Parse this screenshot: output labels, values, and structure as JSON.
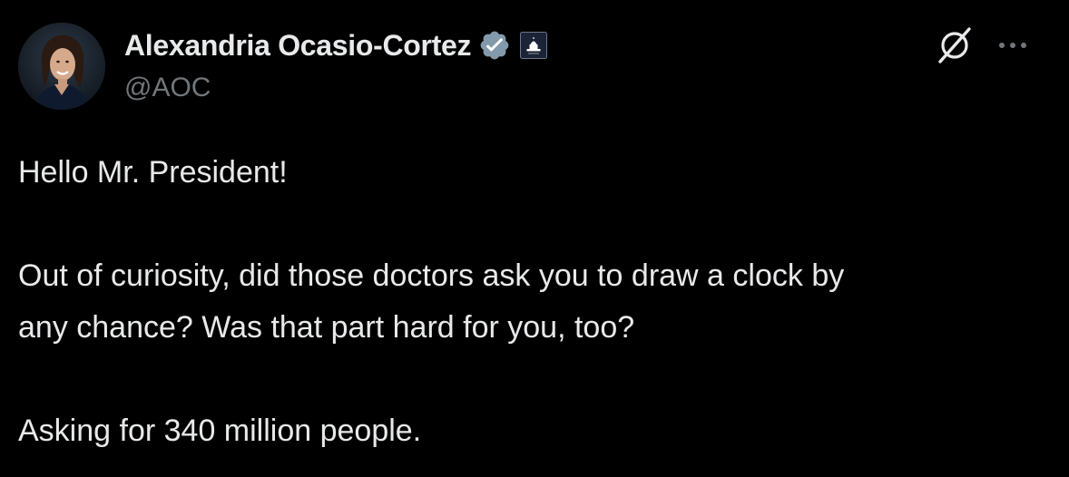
{
  "author": {
    "display_name": "Alexandria Ocasio-Cortez",
    "handle": "@AOC",
    "avatar_icon": "profile-photo",
    "verified_icon": "verified-badge-icon",
    "affiliation_icon": "capitol-building-icon"
  },
  "actions": {
    "grok_icon": "grok-icon",
    "more_icon": "more-options-icon"
  },
  "tweet": {
    "line1": "Hello Mr. President!",
    "line2": "Out of curiosity, did those doctors ask you to draw a clock by",
    "line3": "any chance? Was that part hard for you, too?",
    "line4": "Asking for 340 million people."
  },
  "colors": {
    "background": "#000000",
    "text": "#e7e9ea",
    "secondary": "#71767b",
    "verified_gray": "#829aab"
  }
}
